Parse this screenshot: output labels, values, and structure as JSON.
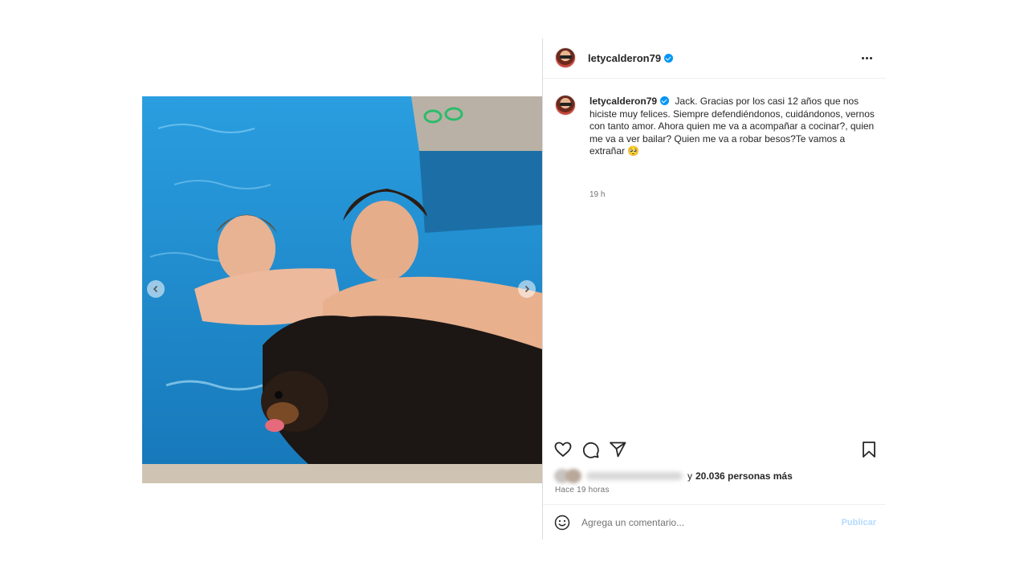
{
  "post": {
    "author": "letycalderon79",
    "verified": true,
    "more_icon": "more-horizontal-icon"
  },
  "media": {
    "prev_icon": "chevron-left-icon",
    "next_icon": "chevron-right-icon",
    "description": "photo"
  },
  "caption": {
    "author": "letycalderon79",
    "text": "Jack. Gracias por los casi 12 años que nos hiciste muy felices. Siempre defendiéndonos, cuidándonos, vernos con tanto amor. Ahora quien me va a acompañar a cocinar?, quien me va a ver bailar? Quien me va a robar besos?Te vamos a extrañar 🥺",
    "time": "19 h"
  },
  "actions": {
    "like_icon": "heart-icon",
    "comment_icon": "comment-icon",
    "share_icon": "send-icon",
    "save_icon": "bookmark-icon"
  },
  "likes": {
    "and": "y",
    "count_text": "20.036 personas más"
  },
  "post_time": "Hace 19 horas",
  "comment": {
    "placeholder": "Agrega un comentario...",
    "publish_label": "Publicar",
    "emoji_icon": "smiley-icon"
  },
  "colors": {
    "verified": "#0095f6",
    "publish_disabled": "#b3dbff",
    "pool": "#1e8fd0"
  }
}
